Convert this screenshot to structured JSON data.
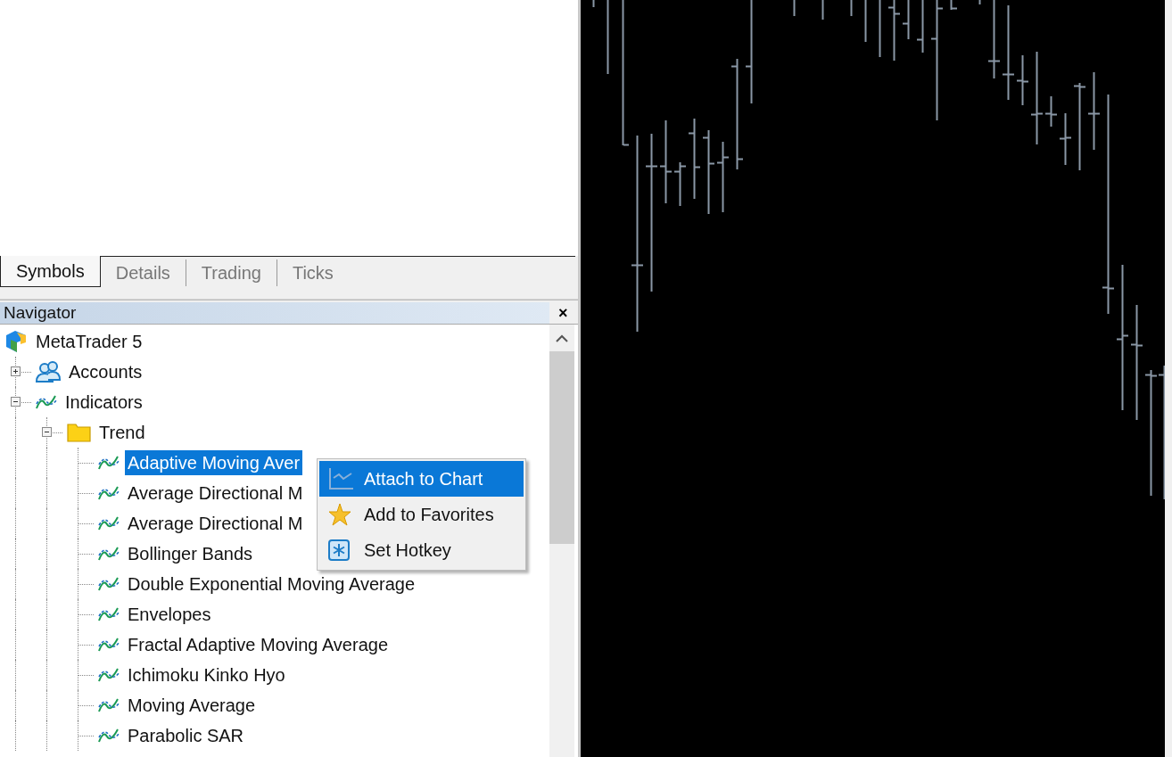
{
  "tabs": [
    {
      "label": "Symbols",
      "selected": true
    },
    {
      "label": "Details",
      "selected": false
    },
    {
      "label": "Trading",
      "selected": false
    },
    {
      "label": "Ticks",
      "selected": false
    }
  ],
  "navigator": {
    "title": "Navigator",
    "close": "×",
    "tree": {
      "label": "MetaTrader 5",
      "kind": "platform",
      "selected": false,
      "children": [
        {
          "label": "Accounts",
          "kind": "accounts",
          "expanded": false,
          "selected": false
        },
        {
          "label": "Indicators",
          "kind": "indicator",
          "expanded": true,
          "selected": false,
          "children": [
            {
              "label": "Trend",
              "kind": "folder",
              "expanded": true,
              "selected": false,
              "children": [
                {
                  "label": "Adaptive Moving Aver",
                  "kind": "indicator",
                  "selected": true
                },
                {
                  "label": "Average Directional M",
                  "kind": "indicator",
                  "selected": false
                },
                {
                  "label": "Average Directional M",
                  "kind": "indicator",
                  "selected": false
                },
                {
                  "label": "Bollinger Bands",
                  "kind": "indicator",
                  "selected": false
                },
                {
                  "label": "Double Exponential Moving Average",
                  "kind": "indicator",
                  "selected": false
                },
                {
                  "label": "Envelopes",
                  "kind": "indicator",
                  "selected": false
                },
                {
                  "label": "Fractal Adaptive Moving Average",
                  "kind": "indicator",
                  "selected": false
                },
                {
                  "label": "Ichimoku Kinko Hyo",
                  "kind": "indicator",
                  "selected": false
                },
                {
                  "label": "Moving Average",
                  "kind": "indicator",
                  "selected": false
                },
                {
                  "label": "Parabolic SAR",
                  "kind": "indicator",
                  "selected": false
                }
              ]
            }
          ]
        }
      ]
    }
  },
  "context_menu": [
    {
      "label": "Attach to Chart",
      "kind": "chart",
      "selected": true
    },
    {
      "label": "Add to Favorites",
      "kind": "star",
      "selected": false
    },
    {
      "label": "Set Hotkey",
      "kind": "hotkey",
      "selected": false
    }
  ]
}
